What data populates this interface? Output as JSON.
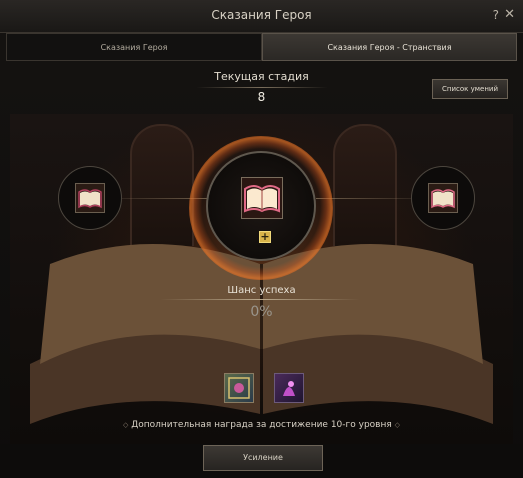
{
  "window": {
    "title": "Сказания Героя",
    "help_label": "?",
    "close_label": "✕"
  },
  "tabs": [
    {
      "label": "Сказания Героя"
    },
    {
      "label": "Сказания Героя - Странствия"
    }
  ],
  "stage": {
    "label": "Текущая стадия",
    "value": "8"
  },
  "skills_button": {
    "label": "Список умений"
  },
  "slots": {
    "main_icon": "open-book-icon",
    "left_icon": "open-book-icon",
    "right_icon": "open-book-icon",
    "plus_label": "+"
  },
  "success": {
    "label": "Шанс успеха",
    "value": "0%"
  },
  "rewards": {
    "items": [
      {
        "icon": "gem-item-icon"
      },
      {
        "icon": "potion-item-icon"
      }
    ],
    "text": "Дополнительная награда за достижение 10-го уровня"
  },
  "enhance_button": {
    "label": "Усиление"
  },
  "colors": {
    "accent_gold": "#d9b44a",
    "glow_orange": "#f07828",
    "book_pink": "#e06a86"
  }
}
